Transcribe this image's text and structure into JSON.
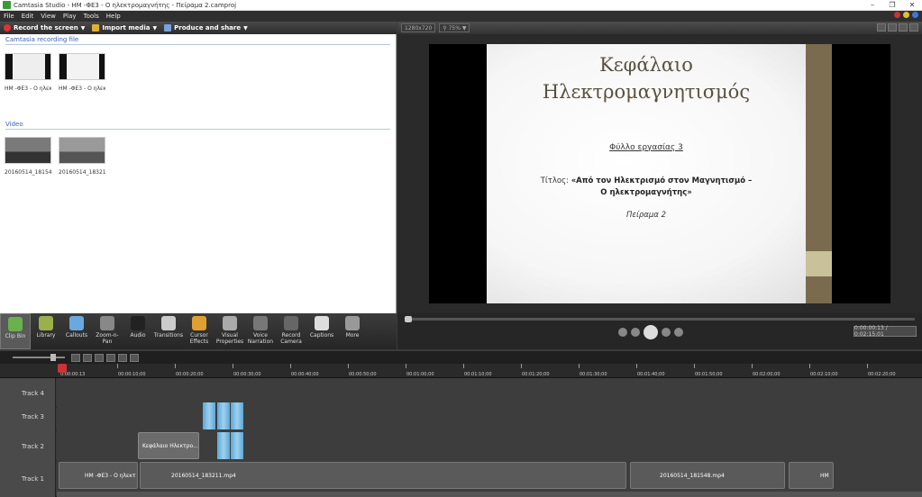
{
  "window": {
    "title": "Camtasia Studio - ΗΜ -ΦΕ3 - Ο ηλεκτρομαγνήτης - Πείραμα 2.camproj"
  },
  "menu": [
    "File",
    "Edit",
    "View",
    "Play",
    "Tools",
    "Help"
  ],
  "toolbar": {
    "record": "Record the screen",
    "import": "Import media",
    "produce": "Produce and share"
  },
  "clipbin": {
    "section_recording": "Camtasia recording file",
    "recordings": [
      "ΗΜ -ΦΕ3 - Ο ηλεκτρομαγνήτη...",
      "ΗΜ -ΦΕ3 - Ο ηλεκτρομαγνήτη..."
    ],
    "section_video": "Video",
    "videos": [
      "20160514_181548....",
      "20160514_183211...."
    ]
  },
  "preview": {
    "dimensions": "1280x720",
    "zoom": "75%",
    "slide": {
      "title_line1": "Κεφάλαιο",
      "title_line2": "Ηλεκτρομαγνητισμός",
      "worksheet": "Φύλλο εργασίας 3",
      "subject_prefix": "Τίτλος:",
      "subject_bold1": "«Από τον Ηλεκτρισμό στον Μαγνητισμό –",
      "subject_bold2": "Ο ηλεκτρομαγνήτης»",
      "experiment": "Πείραμα 2"
    },
    "time": "0:00:00:13 / 0:02:15:01"
  },
  "tasks": [
    {
      "label": "Clip Bin",
      "color": "#6ab04c"
    },
    {
      "label": "Library",
      "color": "#9ab04c"
    },
    {
      "label": "Callouts",
      "color": "#6aa8e0"
    },
    {
      "label": "Zoom-n-Pan",
      "color": "#888888"
    },
    {
      "label": "Audio",
      "color": "#222222"
    },
    {
      "label": "Transitions",
      "color": "#cccccc"
    },
    {
      "label": "Cursor Effects",
      "color": "#e0a030"
    },
    {
      "label": "Visual Properties",
      "color": "#aaaaaa"
    },
    {
      "label": "Voice Narration",
      "color": "#777777"
    },
    {
      "label": "Record Camera",
      "color": "#666666"
    },
    {
      "label": "Captions",
      "color": "#dddddd"
    },
    {
      "label": "More",
      "color": "#999999"
    }
  ],
  "ruler": [
    "0:00:00:13",
    "00:00:10;00",
    "00:00:20;00",
    "00:00:30;00",
    "00:00:40;00",
    "00:00:50;00",
    "00:01:00;00",
    "00:01:10;00",
    "00:01:20;00",
    "00:01:30;00",
    "00:01:40;00",
    "00:01:50;00",
    "00:02:00;00",
    "00:02:10;00",
    "00:02:20;00"
  ],
  "tracks": {
    "track4": "Track 4",
    "track3": "Track 3",
    "track2": "Track 2",
    "track1": "Track 1",
    "track2_clip": "Κεφάλαιο Ηλεκτρο...",
    "track1_clip1": "ΗΜ -ΦΕ3 - Ο ηλεκτ",
    "track1_clip2": "20160514_183211.mp4",
    "track1_clip3": "20160514_181548.mp4",
    "track1_clip4": "ΗΜ"
  }
}
